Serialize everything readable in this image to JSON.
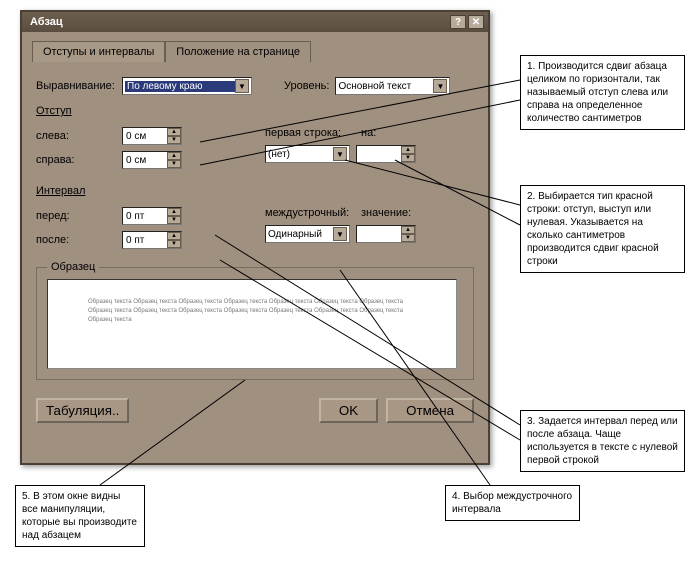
{
  "window": {
    "title": "Абзац"
  },
  "tabs": {
    "t1": "Отступы и интервалы",
    "t2": "Положение на странице"
  },
  "labels": {
    "align": "Выравнивание:",
    "level": "Уровень:",
    "indent": "Отступ",
    "left": "слева:",
    "right": "справа:",
    "firstline": "первая строка:",
    "by": "на:",
    "interval": "Интервал",
    "before": "перед:",
    "after": "после:",
    "spacing": "междустрочный:",
    "value": "значение:",
    "sample": "Образец"
  },
  "values": {
    "align": "По левому краю",
    "level": "Основной текст",
    "left": "0 см",
    "right": "0 см",
    "firstline": "(нет)",
    "by": "",
    "before": "0 пт",
    "after": "0 пт",
    "spacing": "Одинарный",
    "value": ""
  },
  "buttons": {
    "tabulation": "Табуляция..",
    "ok": "OK",
    "cancel": "Отмена"
  },
  "preview_text": "Образец текста Образец текста Образец текста Образец текста Образец текста Образец текста Образец текста Образец текста Образец текста Образец текста Образец текста Образец текста Образец текста Образец текста Образец текста",
  "annotations": {
    "a1": "1. Производится сдвиг абзаца целиком по горизонтали, так называемый отступ слева или справа на определенное количество сантиметров",
    "a2": "2. Выбирается тип красной строки: отступ, выступ или нулевая. Указывается на сколько сантиметров производится сдвиг красной строки",
    "a3": "3. Задается интервал перед или после абзаца. Чаще используется в тексте с нулевой первой строкой",
    "a4": "4. Выбор междустрочного интервала",
    "a5": "5. В этом окне видны все манипуляции, которые вы производите над абзацем"
  }
}
